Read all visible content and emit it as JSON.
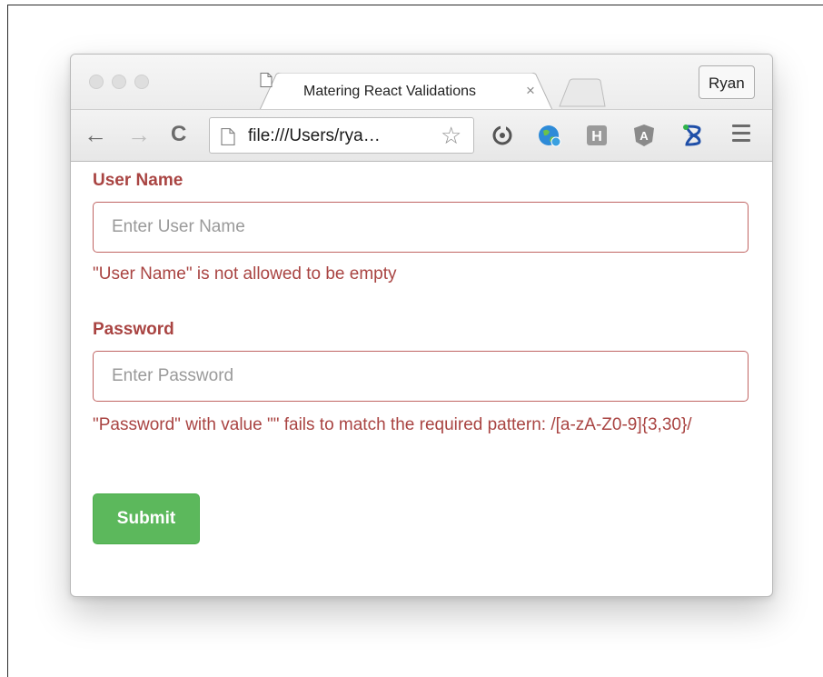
{
  "browser": {
    "tab_title": "Matering React Validations",
    "tab_close": "×",
    "profile_name": "Ryan",
    "address": "file:///Users/rya…",
    "nav": {
      "back": "←",
      "forward": "→",
      "reload": "C"
    },
    "extensions": [
      "sync-icon",
      "globe-icon",
      "h-extension-icon",
      "angular-shield-icon",
      "hourglass-icon"
    ]
  },
  "form": {
    "username": {
      "label": "User Name",
      "placeholder": "Enter User Name",
      "value": "",
      "error": "\"User Name\" is not allowed to be empty"
    },
    "password": {
      "label": "Password",
      "placeholder": "Enter Password",
      "value": "",
      "error": "\"Password\" with value \"\" fails to match the required pattern: /[a-zA-Z0-9]{3,30}/"
    },
    "submit_label": "Submit"
  },
  "colors": {
    "error": "#a94442",
    "submit": "#5cb85c"
  }
}
